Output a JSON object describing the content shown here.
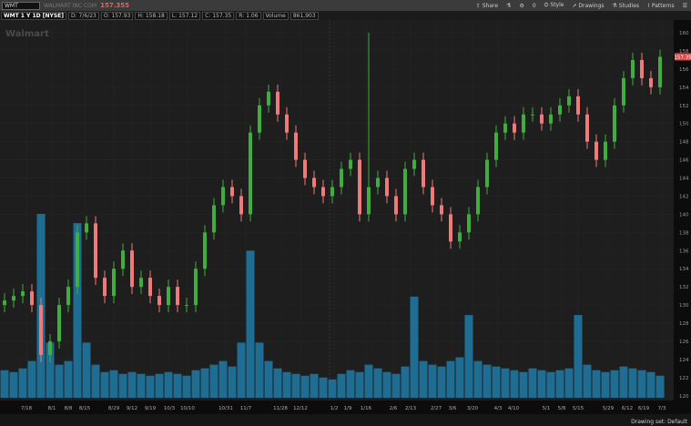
{
  "toolbar": {
    "symbol": "WMT",
    "company": "WALMART INC COM",
    "last": "157.355",
    "share": "Share",
    "style": "Style",
    "drawings": "Drawings",
    "studies": "Studies",
    "patterns": "Patterns",
    "zero": "0"
  },
  "header": {
    "title": "WMT 1 Y 1D [NYSE]",
    "date": "D: 7/6/23",
    "open": "O: 157.93",
    "high": "H: 158.18",
    "low": "L: 157.12",
    "close": "C: 157.35",
    "range": "R: 1.06",
    "volume_label": "Volume",
    "volume": "861,903"
  },
  "watermark": "Walmart",
  "status": {
    "drawing_set": "Drawing set: Default"
  },
  "colors": {
    "up": "#3fae3f",
    "down": "#f07a7a",
    "volume": "#1f6d92",
    "last_price_tag": "#e04848"
  },
  "chart_data": {
    "type": "candlestick",
    "title": "",
    "ylim": [
      119,
      161
    ],
    "yticks": [
      120,
      122,
      124,
      126,
      128,
      130,
      132,
      134,
      136,
      138,
      140,
      142,
      144,
      146,
      148,
      150,
      152,
      154,
      156,
      158,
      160
    ],
    "xticks": [
      "7/18",
      "8/1",
      "8/8",
      "8/15",
      "8/29",
      "9/12",
      "9/19",
      "10/3",
      "10/10",
      "10/31",
      "11/7",
      "11/28",
      "12/12",
      "1/2",
      "1/9",
      "1/16",
      "2/6",
      "2/13",
      "2/27",
      "3/6",
      "3/20",
      "4/3",
      "4/10",
      "5/1",
      "5/8",
      "5/15",
      "5/29",
      "6/12",
      "6/19",
      "7/3"
    ],
    "close": [
      130.5,
      131,
      131.5,
      130,
      124.5,
      126,
      130,
      132,
      138,
      139,
      133,
      131,
      134,
      136,
      132,
      133,
      131,
      130,
      132,
      130,
      130,
      134,
      138,
      141,
      143,
      142,
      140,
      149,
      152,
      153.5,
      151,
      149,
      146,
      144,
      143,
      142,
      143,
      145,
      146,
      140,
      143,
      144,
      142,
      140,
      145,
      146,
      143,
      141,
      140,
      137,
      138,
      140,
      143,
      146,
      149,
      150,
      149,
      151,
      151,
      150,
      151,
      152,
      153,
      151,
      148,
      146,
      148,
      152,
      155,
      157,
      155,
      154,
      157.35
    ],
    "spike": {
      "index": 40,
      "high": 160
    },
    "volume_relative": [
      0.15,
      0.14,
      0.16,
      0.2,
      1.0,
      0.3,
      0.18,
      0.2,
      0.95,
      0.3,
      0.18,
      0.14,
      0.15,
      0.13,
      0.14,
      0.13,
      0.12,
      0.13,
      0.14,
      0.13,
      0.12,
      0.15,
      0.16,
      0.18,
      0.2,
      0.17,
      0.3,
      0.8,
      0.3,
      0.2,
      0.16,
      0.14,
      0.13,
      0.12,
      0.13,
      0.11,
      0.1,
      0.13,
      0.15,
      0.14,
      0.18,
      0.16,
      0.14,
      0.13,
      0.17,
      0.55,
      0.2,
      0.18,
      0.17,
      0.2,
      0.22,
      0.45,
      0.2,
      0.18,
      0.17,
      0.16,
      0.15,
      0.14,
      0.16,
      0.15,
      0.14,
      0.15,
      0.16,
      0.45,
      0.18,
      0.15,
      0.14,
      0.15,
      0.17,
      0.16,
      0.15,
      0.14,
      0.12
    ],
    "last_price": "157.35"
  }
}
